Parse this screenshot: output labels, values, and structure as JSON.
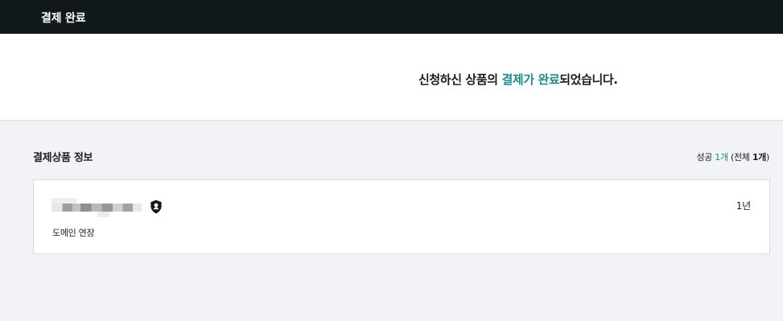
{
  "header": {
    "title": "결제 완료"
  },
  "confirmation": {
    "prefix": "신청하신 상품의 ",
    "highlight": "결제가 완료",
    "suffix": "되었습니다."
  },
  "section": {
    "title": "결제상품 정보",
    "success_label": "성공",
    "success_count": "1개",
    "total_prefix": "(전체 ",
    "total_count": "1개",
    "total_suffix": ")"
  },
  "item": {
    "period": "1년",
    "type": "도메인 연장",
    "badge_icon": "shield-user-icon"
  },
  "colors": {
    "header_bg": "#111819",
    "accent": "#1c8c8c",
    "page_bg": "#f2f3f6"
  }
}
